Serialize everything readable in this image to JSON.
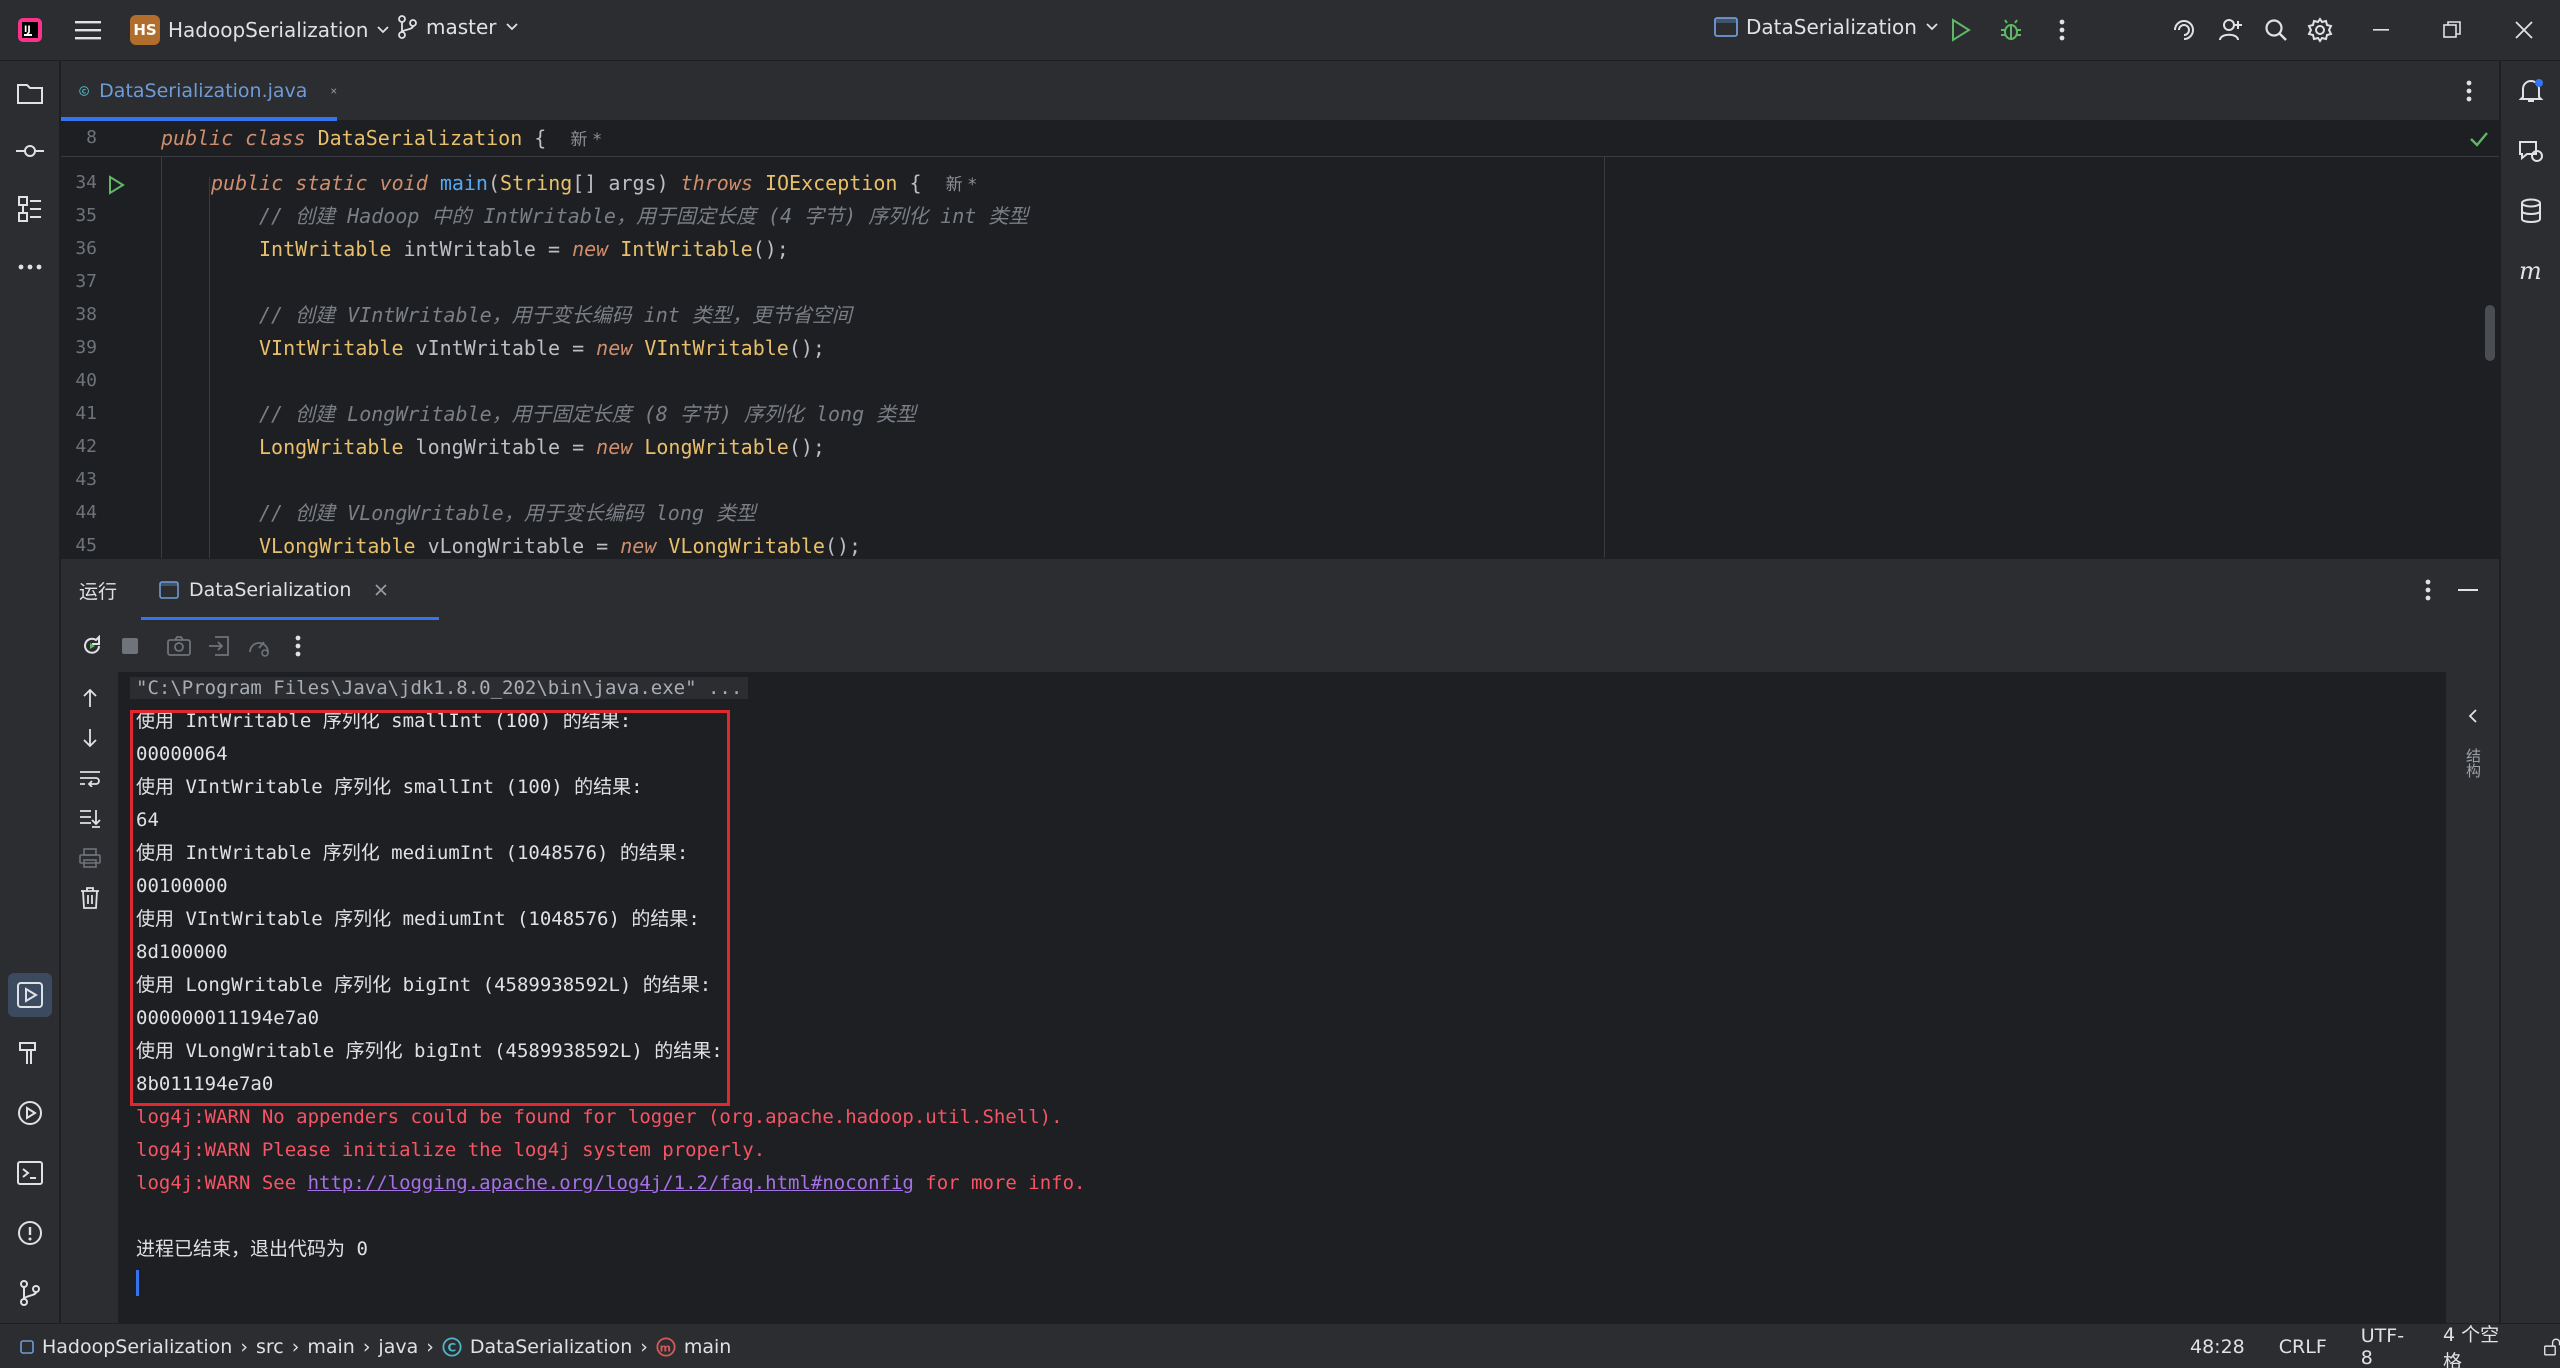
{
  "titlebar": {
    "project_badge": "HS",
    "project_name": "HadoopSerialization",
    "branch": "master",
    "run_config": "DataSerialization"
  },
  "editor": {
    "tab_label": "DataSerialization.java",
    "sticky": {
      "line_no": "8",
      "hint": "新 *"
    },
    "hint_main": "新 *",
    "lines": [
      {
        "no": "34"
      },
      {
        "no": "35"
      },
      {
        "no": "36"
      },
      {
        "no": "37"
      },
      {
        "no": "38"
      },
      {
        "no": "39"
      },
      {
        "no": "40"
      },
      {
        "no": "41"
      },
      {
        "no": "42"
      },
      {
        "no": "43"
      },
      {
        "no": "44"
      },
      {
        "no": "45"
      }
    ],
    "code": {
      "c35": "// 创建 Hadoop 中的 IntWritable，用于固定长度 (4 字节) 序列化 int 类型",
      "c38": "// 创建 VIntWritable，用于变长编码 int 类型，更节省空间",
      "c41": "// 创建 LongWritable，用于固定长度 (8 字节) 序列化 long 类型",
      "c44": "// 创建 VLongWritable，用于变长编码 long 类型"
    }
  },
  "run_panel": {
    "title": "运行",
    "tab_label": "DataSerialization",
    "console": {
      "cmd": "\"C:\\Program Files\\Java\\jdk1.8.0_202\\bin\\java.exe\" ...",
      "output": [
        "使用 IntWritable 序列化 smallInt (100) 的结果:",
        "00000064",
        "使用 VIntWritable 序列化 smallInt (100) 的结果:",
        "64",
        "使用 IntWritable 序列化 mediumInt (1048576) 的结果:",
        "00100000",
        "使用 VIntWritable 序列化 mediumInt (1048576) 的结果:",
        "8d100000",
        "使用 LongWritable 序列化 bigInt (4589938592L) 的结果:",
        "000000011194e7a0",
        "使用 VLongWritable 序列化 bigInt (4589938592L) 的结果:",
        "8b011194e7a0"
      ],
      "warn1": "log4j:WARN No appenders could be found for logger (org.apache.hadoop.util.Shell).",
      "warn2": "log4j:WARN Please initialize the log4j system properly.",
      "warn3_pre": "log4j:WARN See ",
      "warn3_link": "http://logging.apache.org/log4j/1.2/faq.html#noconfig",
      "warn3_post": " for more info.",
      "exit": "进程已结束，退出代码为 0"
    },
    "right_label": "结构"
  },
  "statusbar": {
    "breadcrumb": [
      "HadoopSerialization",
      "src",
      "main",
      "java",
      "DataSerialization",
      "main"
    ],
    "position": "48:28",
    "line_sep": "CRLF",
    "encoding": "UTF-8",
    "indent": "4 个空格"
  }
}
